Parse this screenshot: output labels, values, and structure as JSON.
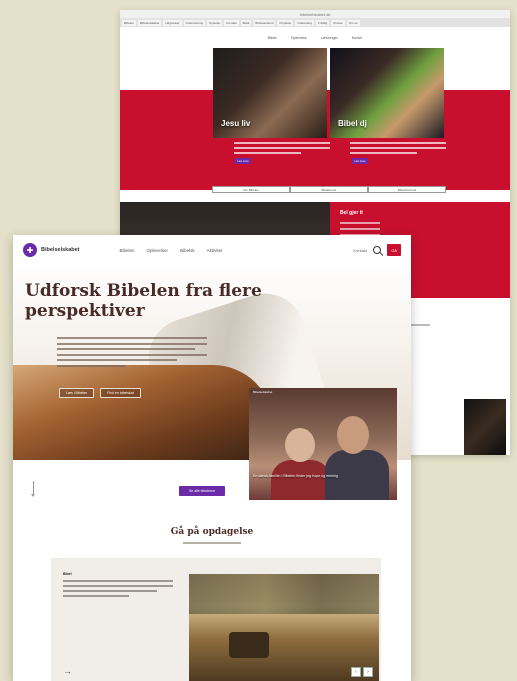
{
  "back_page": {
    "browser_title": "bibelselskabet.dk",
    "nav_strip": [
      "Bibelen",
      "Bibelselskabet",
      "Udgivelser",
      "Undervisning",
      "Nyheder",
      "Kontakt",
      "Butik",
      "Bibelsamfund",
      "Projekter",
      "Indsamling",
      "Frivillig",
      "Presse",
      "Om os"
    ],
    "subnav": [
      "Bibler",
      "Oplevelse",
      "Læsninger",
      "Kurser"
    ],
    "card1_caption": "Jesu liv",
    "card2_caption": "Bibel dj",
    "card_button": "Læs mere",
    "tabs": [
      "Om Bibelen",
      "Bibelkurser",
      "Bibelsamfund"
    ],
    "red_panel_title": "Bel gjer it"
  },
  "front_page": {
    "logo_text": "Bibelselskabet",
    "nav": [
      "Bibelen",
      "Oplevelser",
      "Bibelsk",
      "Aktiviter"
    ],
    "tool_label": "Kontakt",
    "cta_label": "Gå",
    "hero_title": "Udforsk Bibelen fra flere perspektiver",
    "hero_buttons": [
      "Læs i Bibelen",
      "Find en bibelskat"
    ],
    "portrait_label": "Bibelselskabet",
    "portrait_caption": "En dansk-familie: i Bibelen finder jeg hope og mening",
    "purple_button": "Se alle teksterne",
    "section_title": "Gå på opdagelse",
    "card_label": "Bibel",
    "card_arrow": "→",
    "card_nav": [
      "‹",
      "›"
    ]
  },
  "colors": {
    "background": "#e4e0c9",
    "brand_red": "#c8102e",
    "brand_purple": "#6b2aa8",
    "title_brown": "#4a2a26"
  }
}
